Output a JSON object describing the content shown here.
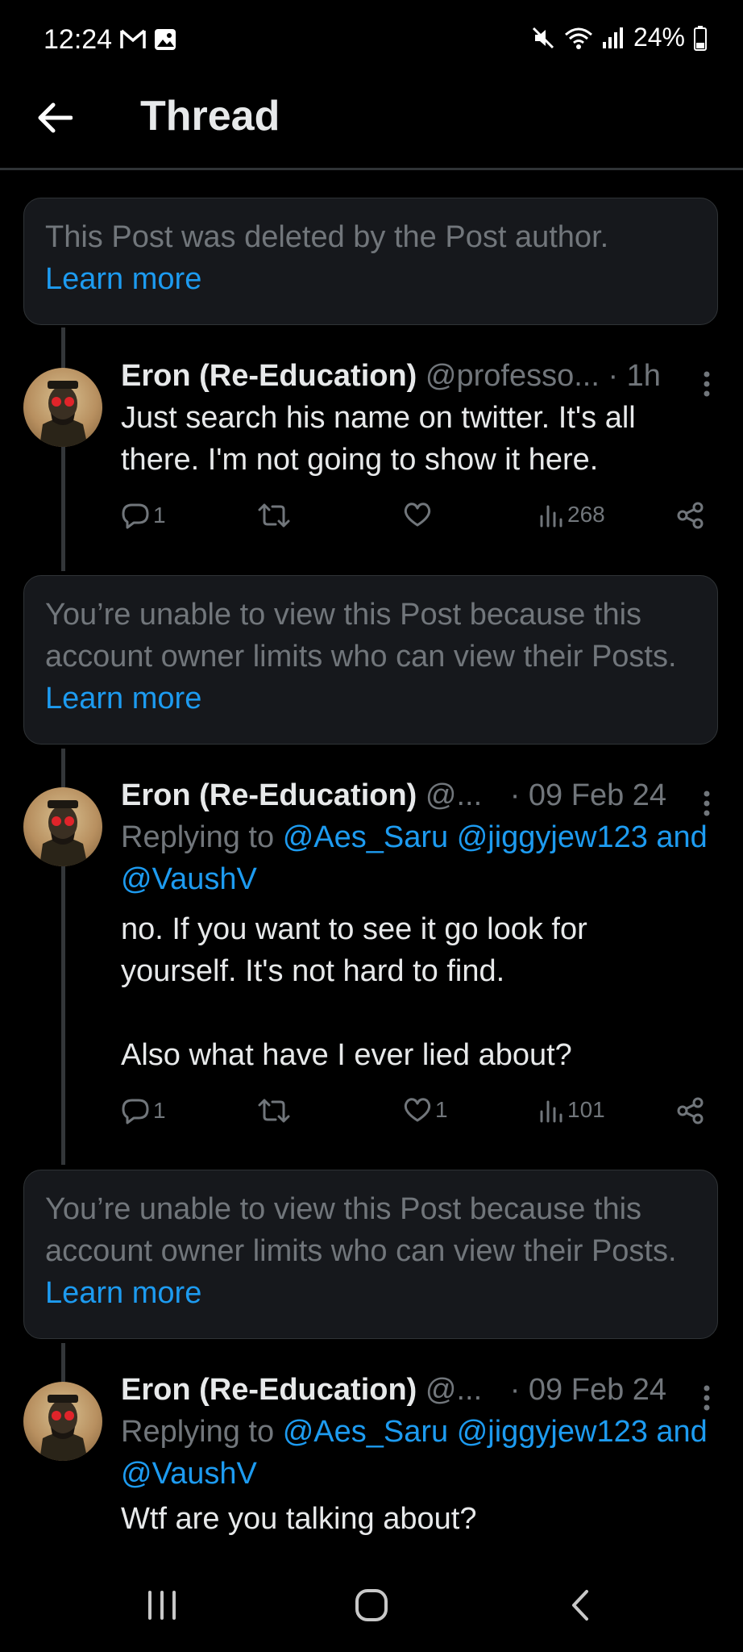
{
  "status_bar": {
    "time": "12:24",
    "battery": "24%"
  },
  "header": {
    "title": "Thread"
  },
  "notices": [
    {
      "text": "This Post was deleted by the Post author.",
      "link": "Learn more"
    },
    {
      "text": "You’re unable to view this Post because this account owner limits who can view their Posts.",
      "link": "Learn more"
    },
    {
      "text": "You’re unable to view this Post because this account owner limits who can view their Posts.",
      "link": "Learn more"
    }
  ],
  "posts": [
    {
      "name": "Eron (Re-Education)",
      "handle": "@professo...",
      "time": "· 1h",
      "text_lines": [
        "Just search his name on twitter. It's all",
        "there. I'm not going to show it here."
      ],
      "replies": "1",
      "reposts": "",
      "likes": "",
      "views": "268"
    },
    {
      "name": "Eron (Re-Education)",
      "handle": "@...",
      "time": "· 09 Feb 24",
      "replying_label": "Replying to",
      "mentions_line1": "@Aes_Saru @jiggyjew123 and",
      "mentions_line2": "@VaushV",
      "text_lines": [
        "no. If you want to see it go look for",
        "yourself. It's not hard to find.",
        "",
        "Also what have I ever lied about?"
      ],
      "replies": "1",
      "reposts": "",
      "likes": "1",
      "views": "101"
    },
    {
      "name": "Eron (Re-Education)",
      "handle": "@...",
      "time": "· 09 Feb 24",
      "replying_label": "Replying to",
      "mentions_line1": "@Aes_Saru @jiggyjew123 and",
      "mentions_line2": "@VaushV",
      "text_lines": [
        "Wtf are you talking about?"
      ]
    }
  ],
  "icons": {
    "reply": "reply-icon",
    "repost": "repost-icon",
    "like": "heart-icon",
    "views": "views-icon",
    "share": "share-icon",
    "more": "more-vertical-icon"
  },
  "colors": {
    "background": "#000000",
    "link": "#1d9bf0",
    "muted": "#71767b",
    "card": "#16181c"
  }
}
